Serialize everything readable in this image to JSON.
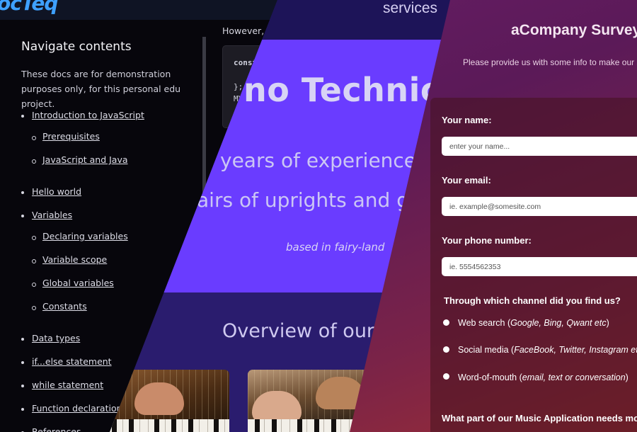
{
  "docs": {
    "logo": "ocTeq",
    "nav_title": "Navigate contents",
    "nav_intro": "These docs are for demonstration purposes only, for this personal edu project.",
    "toc": [
      {
        "label": "Introduction to JavaScript",
        "level": 1
      },
      {
        "label": "Prerequisites",
        "level": 2
      },
      {
        "label": "JavaScript and Java",
        "level": 2
      },
      {
        "label": "Hello world",
        "level": 1
      },
      {
        "label": "Variables",
        "level": 1
      },
      {
        "label": "Declaring variables",
        "level": 2
      },
      {
        "label": "Variable scope",
        "level": 2
      },
      {
        "label": "Global variables",
        "level": 2
      },
      {
        "label": "Constants",
        "level": 2
      },
      {
        "label": "Data types",
        "level": 1
      },
      {
        "label": "if...else statement",
        "level": 1
      },
      {
        "label": "while statement",
        "level": 1
      },
      {
        "label": "Function declarations",
        "level": 1
      },
      {
        "label": "References",
        "level": 1
      }
    ],
    "body_text": "However, ob",
    "code_lines": [
      "const",
      "",
      "};",
      "MY"
    ]
  },
  "technician": {
    "header_text": "services",
    "hero_title": "no Technicia",
    "hero_line1": "years of experience in",
    "hero_line2": "airs of uprights and gra",
    "hero_tagline": "based in fairy-land",
    "section_title": "Overview of our s"
  },
  "survey": {
    "title": "aCompany Survey",
    "subtitle": "Please provide us with some info to make our s",
    "name_label": "Your name:",
    "name_placeholder": "enter your name...",
    "email_label": "Your email:",
    "email_placeholder": "ie. example@somesite.com",
    "phone_label": "Your phone number:",
    "phone_placeholder": "ie. 5554562353",
    "channel_label": "Through which channel did you find us?",
    "channels": [
      {
        "label": "Web search (",
        "detail": "Google, Bing, Qwant etc",
        "end": ")"
      },
      {
        "label": "Social media (",
        "detail": "FaceBook, Twitter, Instagram etc",
        "end": ""
      },
      {
        "label": "Word-of-mouth (",
        "detail": "email, text or conversation",
        "end": ")"
      }
    ],
    "music_label": "What part of our Music Application needs most"
  }
}
